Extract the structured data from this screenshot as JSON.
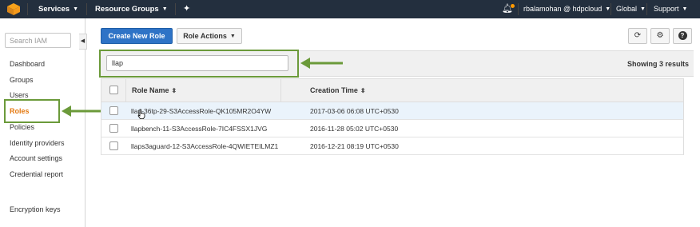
{
  "topnav": {
    "services_label": "Services",
    "resource_groups_label": "Resource Groups",
    "user_label": "rbalamohan @ hdpcloud",
    "region_label": "Global",
    "support_label": "Support"
  },
  "sidebar": {
    "search_placeholder": "Search IAM",
    "items": [
      {
        "label": "Dashboard"
      },
      {
        "label": "Groups"
      },
      {
        "label": "Users"
      },
      {
        "label": "Roles"
      },
      {
        "label": "Policies"
      },
      {
        "label": "Identity providers"
      },
      {
        "label": "Account settings"
      },
      {
        "label": "Credential report"
      },
      {
        "label": "Encryption keys"
      }
    ]
  },
  "toolbar": {
    "create_label": "Create New Role",
    "actions_label": "Role Actions"
  },
  "filter": {
    "value": "llap",
    "results_text": "Showing 3 results"
  },
  "table": {
    "columns": [
      "Role Name",
      "Creation Time"
    ],
    "rows": [
      {
        "name": "llap-36tp-29-S3AccessRole-QK105MR2O4YW",
        "created": "2017-03-06 06:08 UTC+0530"
      },
      {
        "name": "llapbench-11-S3AccessRole-7IC4FSSX1JVG",
        "created": "2016-11-28 05:02 UTC+0530"
      },
      {
        "name": "llaps3aguard-12-S3AccessRole-4QWIETEILMZ1",
        "created": "2016-12-21 08:19 UTC+0530"
      }
    ]
  },
  "colors": {
    "nav_bg": "#232f3e",
    "primary_button": "#2e73c6",
    "active_nav": "#e47911",
    "annotation_green": "#6b9a3a",
    "notification_dot": "#f90"
  }
}
